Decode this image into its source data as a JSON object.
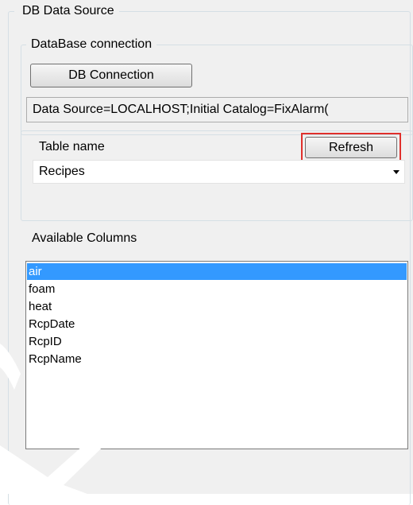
{
  "outer_group": {
    "legend": "DB Data Source"
  },
  "db_group": {
    "legend": "DataBase connection",
    "button_label": "DB Connection",
    "connection_string": "Data Source=LOCALHOST;Initial Catalog=FixAlarm("
  },
  "table_group": {
    "label": "Table name",
    "refresh_label": "Refresh",
    "selected_table": "Recipes"
  },
  "columns": {
    "label": "Available Columns",
    "items": [
      "air",
      "foam",
      "heat",
      "RcpDate",
      "RcpID",
      "RcpName"
    ],
    "selected_index": 0
  },
  "colors": {
    "selection": "#3399ff",
    "highlight": "#e0302c"
  },
  "icons": {
    "combo_arrow": "dropdown-arrow-icon"
  }
}
